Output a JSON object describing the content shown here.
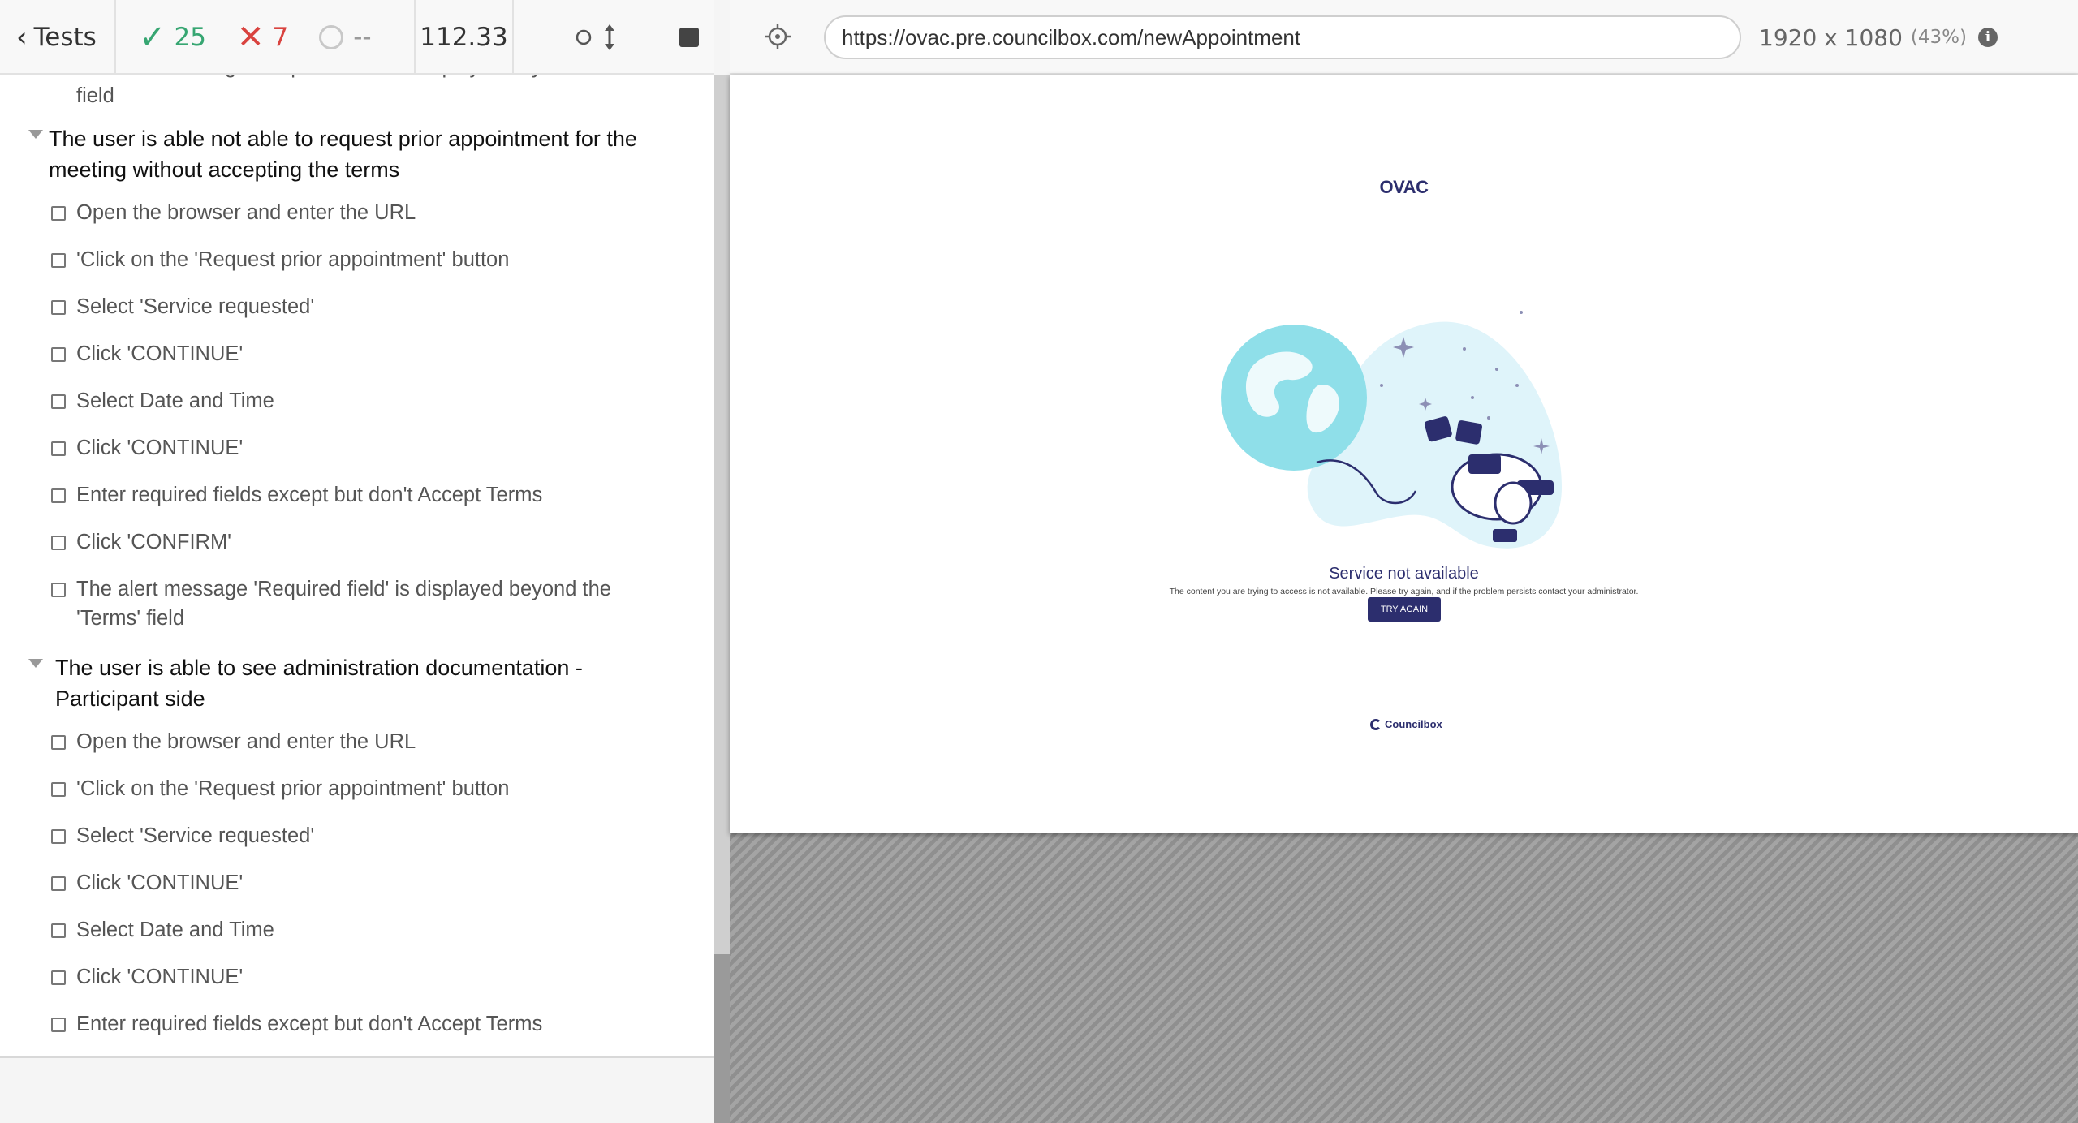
{
  "reporter": {
    "back_label": "Tests",
    "passed_count": "25",
    "failed_count": "7",
    "pending_count": "--",
    "duration": "112.33",
    "colors": {
      "pass": "#37a672",
      "fail": "#d9433f"
    }
  },
  "steps_top": [
    "The alert message 'Required field' is displayed beyond the 'Email' field"
  ],
  "suite1": {
    "title": "The user is able not able to request prior appointment for the meeting without accepting the terms",
    "steps": [
      "Open the browser and enter the URL",
      "'Click on the 'Request prior appointment' button",
      "Select 'Service requested'",
      "Click 'CONTINUE'",
      "Select Date and Time",
      "Click 'CONTINUE'",
      "Enter required fields except but don't Accept Terms",
      "Click 'CONFIRM'",
      "The alert message 'Required field' is displayed beyond the 'Terms' field"
    ]
  },
  "suite2": {
    "title": "The user is able to see administration documentation - Participant side",
    "steps": [
      "Open the browser and enter the URL",
      "'Click on the 'Request prior appointment' button",
      "Select 'Service requested'",
      "Click 'CONTINUE'",
      "Select Date and Time",
      "Click 'CONTINUE'",
      "Enter required fields except but don't Accept Terms"
    ]
  },
  "aut": {
    "url": "https://ovac.pre.councilbox.com/newAppointment",
    "viewport": "1920 x 1080",
    "scale": "(43%)",
    "info_glyph": "i"
  },
  "app": {
    "logo": "OVAC",
    "error_title": "Service not available",
    "error_description": "The content you are trying to access is not available. Please try again, and if the problem persists contact your administrator.",
    "try_again_label": "TRY AGAIN",
    "footer_logo": "Councilbox",
    "brand_color": "#2c2e6e"
  }
}
